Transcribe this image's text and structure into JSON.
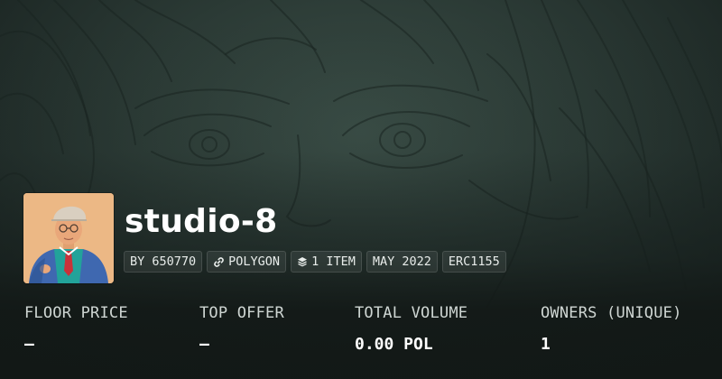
{
  "collection": {
    "name": "studio-8",
    "avatar_icon": "portrait-man-flat-cap-icon",
    "banner_icon": "pencil-sketch-faces-icon"
  },
  "chips": [
    {
      "label": "BY 650770"
    },
    {
      "label": "POLYGON",
      "icon": "link-icon"
    },
    {
      "label": "1 ITEM",
      "icon": "layers-icon"
    },
    {
      "label": "MAY 2022"
    },
    {
      "label": "ERC1155"
    }
  ],
  "stats": [
    {
      "label": "FLOOR PRICE",
      "value": "—"
    },
    {
      "label": "TOP OFFER",
      "value": "—"
    },
    {
      "label": "TOTAL VOLUME",
      "value": "0.00 POL"
    },
    {
      "label": "OWNERS (UNIQUE)",
      "value": "1"
    }
  ],
  "colors": {
    "background": "#1b2623",
    "banner": "#2b3a35",
    "text": "#ffffff",
    "label": "#cfd6d3"
  }
}
